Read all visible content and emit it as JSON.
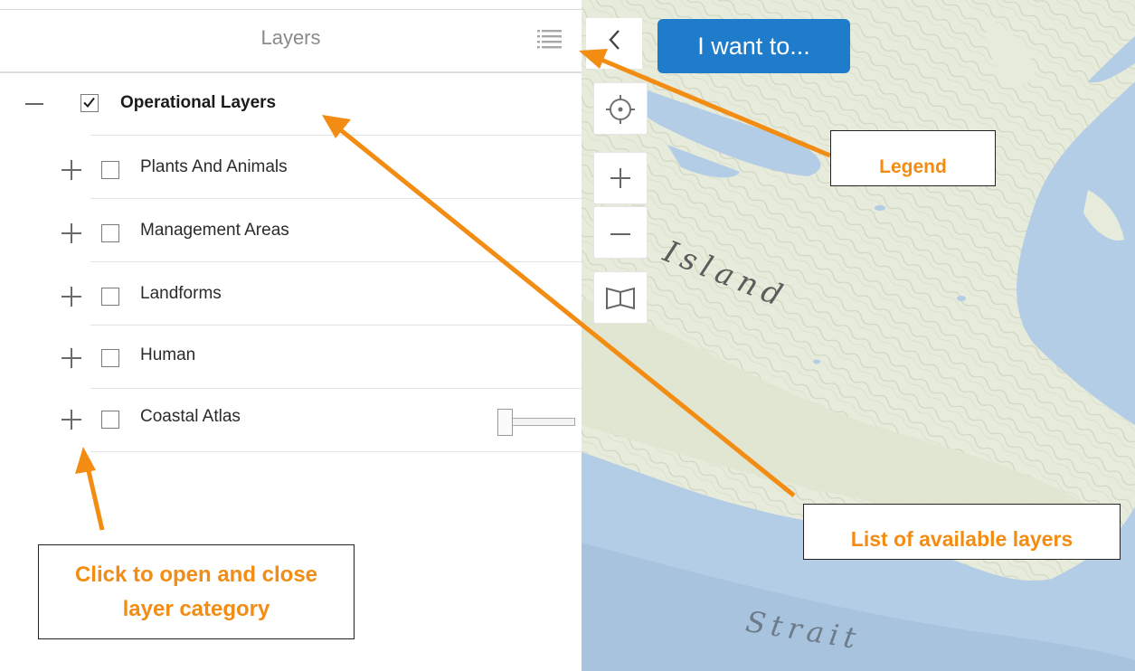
{
  "panel": {
    "title": "Layers",
    "root": {
      "label": "Operational Layers",
      "checked": true,
      "expanded": true
    },
    "layers": [
      {
        "label": "Plants And Animals",
        "checked": false
      },
      {
        "label": "Management Areas",
        "checked": false
      },
      {
        "label": "Landforms",
        "checked": false
      },
      {
        "label": "Human",
        "checked": false
      },
      {
        "label": "Coastal Atlas",
        "checked": false
      }
    ],
    "icons": {
      "legend": "list-icon",
      "expand": "plus-icon",
      "collapse": "minus-icon"
    }
  },
  "map": {
    "i_want_to_label": "I want to...",
    "labels": {
      "island": "Island",
      "strait": "Strait"
    },
    "tools": [
      "crosshair-icon",
      "zoom-in-icon",
      "zoom-out-icon",
      "book-icon"
    ],
    "collapse_icon": "chevron-left-icon"
  },
  "annotations": {
    "legend": "Legend",
    "layers_list": "List of available layers",
    "category_line1": "Click to open and close",
    "category_line2": "layer category"
  },
  "colors": {
    "annotation": "#f28c13",
    "button_blue": "#1f7ccb",
    "water": "#a8c7e3",
    "land": "#e8ecdc"
  }
}
